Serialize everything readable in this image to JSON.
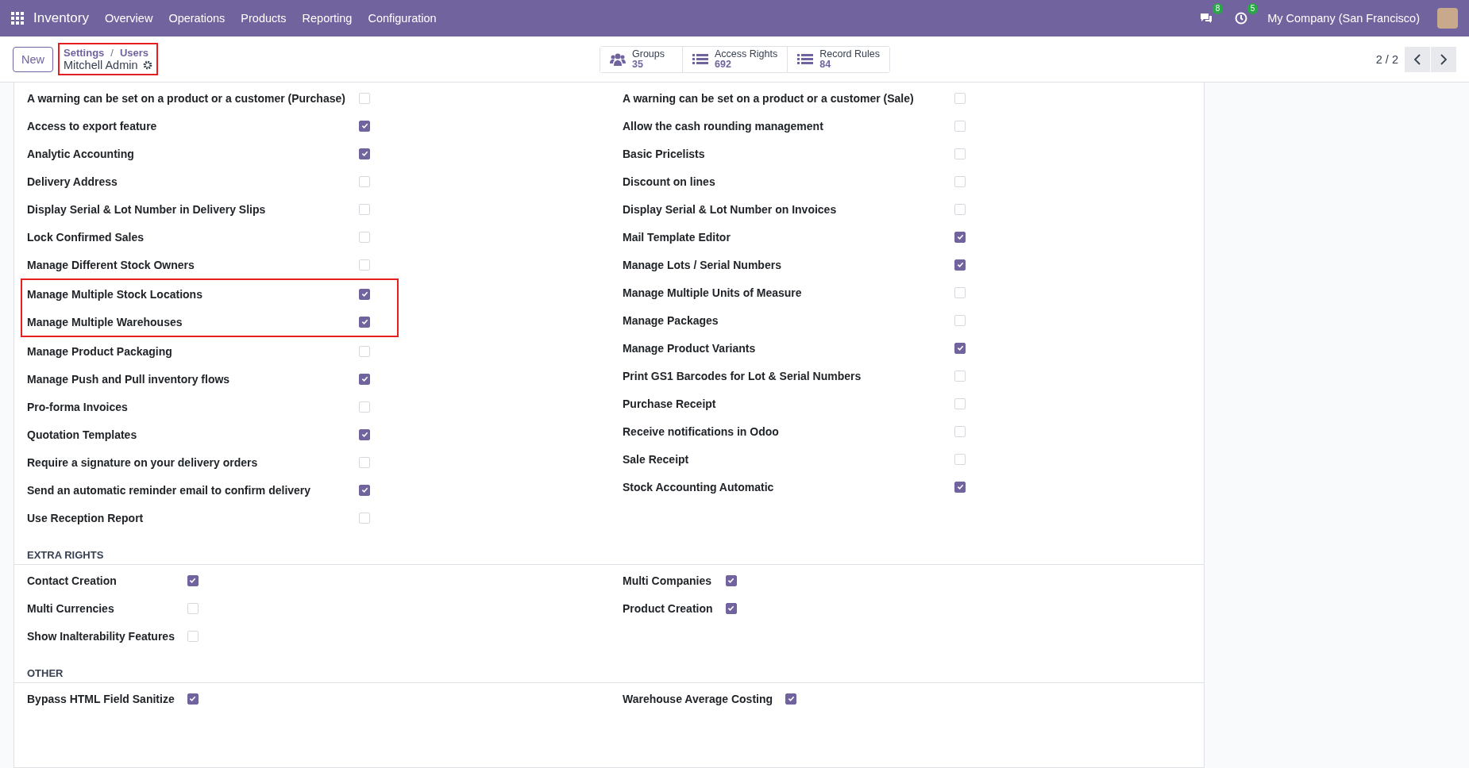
{
  "navbar": {
    "app": "Inventory",
    "menus": [
      "Overview",
      "Operations",
      "Products",
      "Reporting",
      "Configuration"
    ],
    "notifications": [
      {
        "kind": "chat",
        "count": "8"
      },
      {
        "kind": "activity",
        "count": "5"
      }
    ],
    "company": "My Company (San Francisco)"
  },
  "control_panel": {
    "new_button": "New",
    "breadcrumb": {
      "items": [
        "Settings",
        "Users"
      ],
      "separator": "/",
      "record": "Mitchell Admin",
      "highlighted": true
    },
    "stat_buttons": [
      {
        "kind": "groups",
        "label": "Groups",
        "value": "35"
      },
      {
        "kind": "list",
        "label": "Access Rights",
        "value": "692"
      },
      {
        "kind": "list",
        "label": "Record Rules",
        "value": "84"
      }
    ],
    "pager": "2 / 2"
  },
  "sections": [
    {
      "columns": [
        [
          {
            "label": "A warning can be set on a product or a customer (Purchase)",
            "checked": false,
            "highlighted": false
          },
          {
            "label": "Access to export feature",
            "checked": true,
            "highlighted": false
          },
          {
            "label": "Analytic Accounting",
            "checked": true,
            "highlighted": false
          },
          {
            "label": "Delivery Address",
            "checked": false,
            "highlighted": false
          },
          {
            "label": "Display Serial & Lot Number in Delivery Slips",
            "checked": false,
            "highlighted": false
          },
          {
            "label": "Lock Confirmed Sales",
            "checked": false,
            "highlighted": false
          },
          {
            "label": "Manage Different Stock Owners",
            "checked": false,
            "highlighted": false
          },
          {
            "label": "Manage Multiple Stock Locations",
            "checked": true,
            "highlighted": true
          },
          {
            "label": "Manage Multiple Warehouses",
            "checked": true,
            "highlighted": true
          },
          {
            "label": "Manage Product Packaging",
            "checked": false,
            "highlighted": false
          },
          {
            "label": "Manage Push and Pull inventory flows",
            "checked": true,
            "highlighted": false
          },
          {
            "label": "Pro-forma Invoices",
            "checked": false,
            "highlighted": false
          },
          {
            "label": "Quotation Templates",
            "checked": true,
            "highlighted": false
          },
          {
            "label": "Require a signature on your delivery orders",
            "checked": false,
            "highlighted": false
          },
          {
            "label": "Send an automatic reminder email to confirm delivery",
            "checked": true,
            "highlighted": false
          },
          {
            "label": "Use Reception Report",
            "checked": false,
            "highlighted": false
          }
        ],
        [
          {
            "label": "A warning can be set on a product or a customer (Sale)",
            "checked": false,
            "highlighted": false
          },
          {
            "label": "Allow the cash rounding management",
            "checked": false,
            "highlighted": false
          },
          {
            "label": "Basic Pricelists",
            "checked": false,
            "highlighted": false
          },
          {
            "label": "Discount on lines",
            "checked": false,
            "highlighted": false
          },
          {
            "label": "Display Serial & Lot Number on Invoices",
            "checked": false,
            "highlighted": false
          },
          {
            "label": "Mail Template Editor",
            "checked": true,
            "highlighted": false
          },
          {
            "label": "Manage Lots / Serial Numbers",
            "checked": true,
            "highlighted": false
          },
          {
            "label": "Manage Multiple Units of Measure",
            "checked": false,
            "highlighted": false
          },
          {
            "label": "Manage Packages",
            "checked": false,
            "highlighted": false
          },
          {
            "label": "Manage Product Variants",
            "checked": true,
            "highlighted": false
          },
          {
            "label": "Print GS1 Barcodes for Lot & Serial Numbers",
            "checked": false,
            "highlighted": false
          },
          {
            "label": "Purchase Receipt",
            "checked": false,
            "highlighted": false
          },
          {
            "label": "Receive notifications in Odoo",
            "checked": false,
            "highlighted": false
          },
          {
            "label": "Sale Receipt",
            "checked": false,
            "highlighted": false
          },
          {
            "label": "Stock Accounting Automatic",
            "checked": true,
            "highlighted": false
          }
        ]
      ]
    },
    {
      "title": "EXTRA RIGHTS",
      "columns": [
        [
          {
            "label": "Contact Creation",
            "checked": true,
            "highlighted": false
          },
          {
            "label": "Multi Currencies",
            "checked": false,
            "highlighted": false
          },
          {
            "label": "Show Inalterability Features",
            "checked": false,
            "highlighted": false
          }
        ],
        [
          {
            "label": "Multi Companies",
            "checked": true,
            "highlighted": false
          },
          {
            "label": "Product Creation",
            "checked": true,
            "highlighted": false
          }
        ]
      ]
    },
    {
      "title": "OTHER",
      "columns": [
        [
          {
            "label": "Bypass HTML Field Sanitize",
            "checked": true,
            "highlighted": false
          }
        ],
        [
          {
            "label": "Warehouse Average Costing",
            "checked": true,
            "highlighted": false
          }
        ]
      ]
    }
  ]
}
